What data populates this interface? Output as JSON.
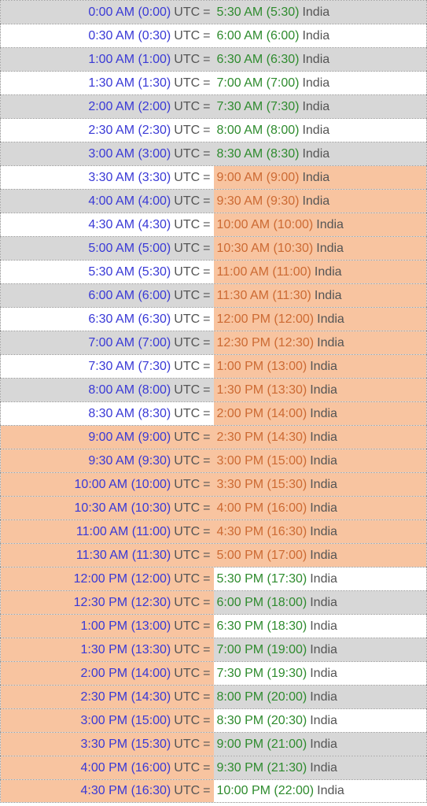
{
  "labels": {
    "utc": "UTC",
    "india": "India",
    "eq": "="
  },
  "rows": [
    {
      "utc_time": "0:00 AM (0:00)",
      "india_time": "5:30 AM (5:30)",
      "utc_bg": "grey",
      "india_bg": "grey",
      "india_business": false
    },
    {
      "utc_time": "0:30 AM (0:30)",
      "india_time": "6:00 AM (6:00)",
      "utc_bg": "white",
      "india_bg": "white",
      "india_business": false
    },
    {
      "utc_time": "1:00 AM (1:00)",
      "india_time": "6:30 AM (6:30)",
      "utc_bg": "grey",
      "india_bg": "grey",
      "india_business": false
    },
    {
      "utc_time": "1:30 AM (1:30)",
      "india_time": "7:00 AM (7:00)",
      "utc_bg": "white",
      "india_bg": "white",
      "india_business": false
    },
    {
      "utc_time": "2:00 AM (2:00)",
      "india_time": "7:30 AM (7:30)",
      "utc_bg": "grey",
      "india_bg": "grey",
      "india_business": false
    },
    {
      "utc_time": "2:30 AM (2:30)",
      "india_time": "8:00 AM (8:00)",
      "utc_bg": "white",
      "india_bg": "white",
      "india_business": false
    },
    {
      "utc_time": "3:00 AM (3:00)",
      "india_time": "8:30 AM (8:30)",
      "utc_bg": "grey",
      "india_bg": "grey",
      "india_business": false
    },
    {
      "utc_time": "3:30 AM (3:30)",
      "india_time": "9:00 AM (9:00)",
      "utc_bg": "white",
      "india_bg": "orange",
      "india_business": true
    },
    {
      "utc_time": "4:00 AM (4:00)",
      "india_time": "9:30 AM (9:30)",
      "utc_bg": "grey",
      "india_bg": "orange",
      "india_business": true
    },
    {
      "utc_time": "4:30 AM (4:30)",
      "india_time": "10:00 AM (10:00)",
      "utc_bg": "white",
      "india_bg": "orange",
      "india_business": true
    },
    {
      "utc_time": "5:00 AM (5:00)",
      "india_time": "10:30 AM (10:30)",
      "utc_bg": "grey",
      "india_bg": "orange",
      "india_business": true
    },
    {
      "utc_time": "5:30 AM (5:30)",
      "india_time": "11:00 AM (11:00)",
      "utc_bg": "white",
      "india_bg": "orange",
      "india_business": true
    },
    {
      "utc_time": "6:00 AM (6:00)",
      "india_time": "11:30 AM (11:30)",
      "utc_bg": "grey",
      "india_bg": "orange",
      "india_business": true
    },
    {
      "utc_time": "6:30 AM (6:30)",
      "india_time": "12:00 PM (12:00)",
      "utc_bg": "white",
      "india_bg": "orange",
      "india_business": true
    },
    {
      "utc_time": "7:00 AM (7:00)",
      "india_time": "12:30 PM (12:30)",
      "utc_bg": "grey",
      "india_bg": "orange",
      "india_business": true
    },
    {
      "utc_time": "7:30 AM (7:30)",
      "india_time": "1:00 PM (13:00)",
      "utc_bg": "white",
      "india_bg": "orange",
      "india_business": true
    },
    {
      "utc_time": "8:00 AM (8:00)",
      "india_time": "1:30 PM (13:30)",
      "utc_bg": "grey",
      "india_bg": "orange",
      "india_business": true
    },
    {
      "utc_time": "8:30 AM (8:30)",
      "india_time": "2:00 PM (14:00)",
      "utc_bg": "white",
      "india_bg": "orange",
      "india_business": true
    },
    {
      "utc_time": "9:00 AM (9:00)",
      "india_time": "2:30 PM (14:30)",
      "utc_bg": "orange",
      "india_bg": "orange",
      "india_business": true
    },
    {
      "utc_time": "9:30 AM (9:30)",
      "india_time": "3:00 PM (15:00)",
      "utc_bg": "orange",
      "india_bg": "orange",
      "india_business": true
    },
    {
      "utc_time": "10:00 AM (10:00)",
      "india_time": "3:30 PM (15:30)",
      "utc_bg": "orange",
      "india_bg": "orange",
      "india_business": true
    },
    {
      "utc_time": "10:30 AM (10:30)",
      "india_time": "4:00 PM (16:00)",
      "utc_bg": "orange",
      "india_bg": "orange",
      "india_business": true
    },
    {
      "utc_time": "11:00 AM (11:00)",
      "india_time": "4:30 PM (16:30)",
      "utc_bg": "orange",
      "india_bg": "orange",
      "india_business": true
    },
    {
      "utc_time": "11:30 AM (11:30)",
      "india_time": "5:00 PM (17:00)",
      "utc_bg": "orange",
      "india_bg": "orange",
      "india_business": true
    },
    {
      "utc_time": "12:00 PM (12:00)",
      "india_time": "5:30 PM (17:30)",
      "utc_bg": "orange",
      "india_bg": "white",
      "india_business": false
    },
    {
      "utc_time": "12:30 PM (12:30)",
      "india_time": "6:00 PM (18:00)",
      "utc_bg": "orange",
      "india_bg": "grey",
      "india_business": false
    },
    {
      "utc_time": "1:00 PM (13:00)",
      "india_time": "6:30 PM (18:30)",
      "utc_bg": "orange",
      "india_bg": "white",
      "india_business": false
    },
    {
      "utc_time": "1:30 PM (13:30)",
      "india_time": "7:00 PM (19:00)",
      "utc_bg": "orange",
      "india_bg": "grey",
      "india_business": false
    },
    {
      "utc_time": "2:00 PM (14:00)",
      "india_time": "7:30 PM (19:30)",
      "utc_bg": "orange",
      "india_bg": "white",
      "india_business": false
    },
    {
      "utc_time": "2:30 PM (14:30)",
      "india_time": "8:00 PM (20:00)",
      "utc_bg": "orange",
      "india_bg": "grey",
      "india_business": false
    },
    {
      "utc_time": "3:00 PM (15:00)",
      "india_time": "8:30 PM (20:30)",
      "utc_bg": "orange",
      "india_bg": "white",
      "india_business": false
    },
    {
      "utc_time": "3:30 PM (15:30)",
      "india_time": "9:00 PM (21:00)",
      "utc_bg": "orange",
      "india_bg": "grey",
      "india_business": false
    },
    {
      "utc_time": "4:00 PM (16:00)",
      "india_time": "9:30 PM (21:30)",
      "utc_bg": "orange",
      "india_bg": "grey",
      "india_business": false
    },
    {
      "utc_time": "4:30 PM (16:30)",
      "india_time": "10:00 PM (22:00)",
      "utc_bg": "orange",
      "india_bg": "white",
      "india_business": false
    }
  ]
}
